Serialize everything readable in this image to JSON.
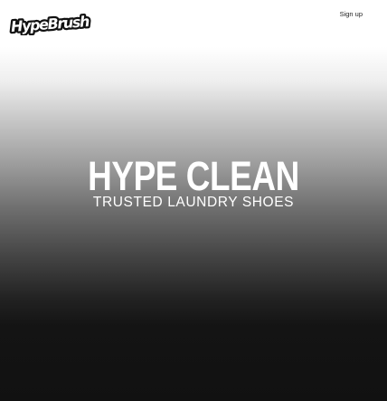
{
  "header": {
    "logo_text": "HypeBrush",
    "signup_label": "Sign up"
  },
  "hero": {
    "title": "HYPE CLEAN",
    "subtitle": "TRUSTED LAUNDRY SHOES"
  },
  "colors": {
    "background_top": "#ffffff",
    "background_bottom": "#111111",
    "hero_text": "#ffffff",
    "logo_fill": "#ffffff",
    "logo_outline": "#111111"
  }
}
